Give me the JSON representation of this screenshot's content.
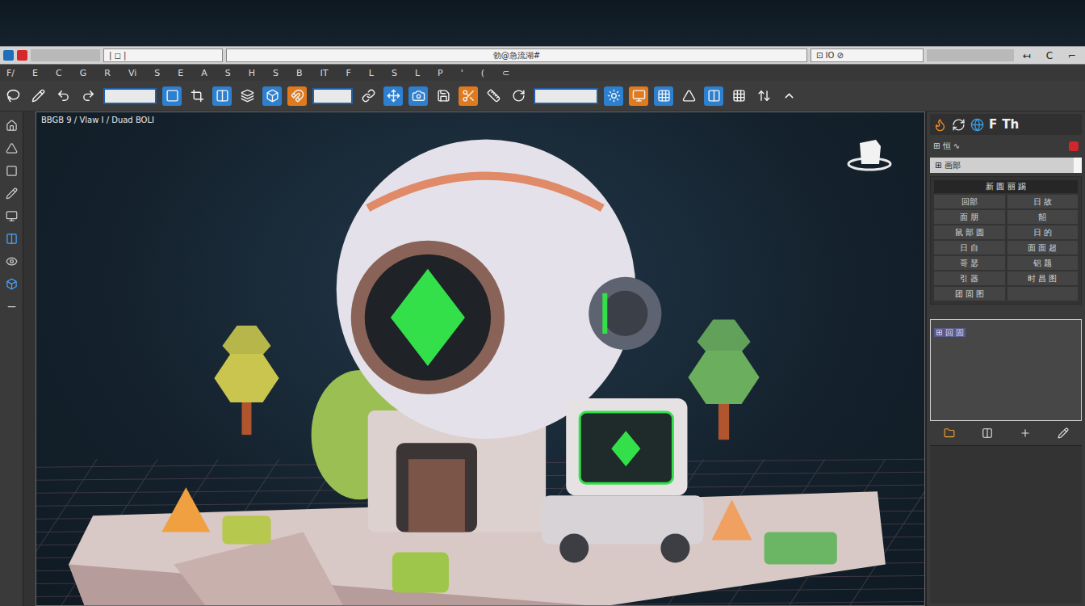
{
  "window": {
    "title": "勃@急流湖#"
  },
  "title_bar": {
    "left_field": "| ◻ |",
    "right_field": "⊡ IO ⊘",
    "controls": [
      "↤",
      "C",
      "⌐"
    ]
  },
  "menu": [
    "F/",
    "E",
    "C",
    "G",
    "R",
    "Vi",
    "S",
    "E",
    "A",
    "S",
    "H",
    "S",
    "B",
    "IT",
    "F",
    "L",
    "S",
    "L",
    "P",
    "'",
    "(",
    "⊂"
  ],
  "viewport": {
    "label": "BBGB 9 / Vlaw I / Duad BOLI"
  },
  "right_panel": {
    "tab_glyphs": [
      "F",
      "Th"
    ],
    "header_row": "⊞ 恒 ∿",
    "field": "⊞ 画部",
    "group_title": "新 圆 丽 踢",
    "rows": [
      [
        "回部",
        "日 故"
      ],
      [
        "面 朋",
        "韶"
      ],
      [
        "鼠 部 圆",
        "日 的"
      ],
      [
        "日 自",
        "面 面 超"
      ],
      [
        "哥 瑟",
        "铝 题"
      ],
      [
        "引 器",
        "时 昌 图"
      ],
      [
        "团 固 图",
        ""
      ]
    ],
    "preview_label": "⊞ 回 固"
  }
}
